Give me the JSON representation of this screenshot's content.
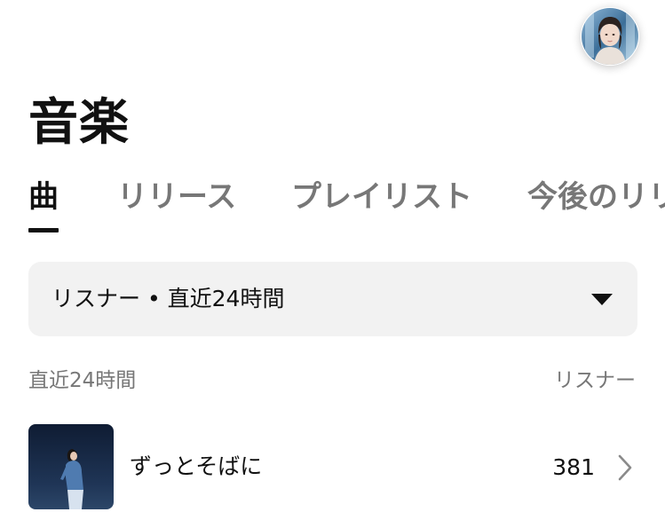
{
  "header": {
    "title": "音楽",
    "avatar_icon": "profile-avatar"
  },
  "tabs": [
    {
      "label": "曲",
      "active": true
    },
    {
      "label": "リリース",
      "active": false
    },
    {
      "label": "プレイリスト",
      "active": false
    },
    {
      "label": "今後のリリース",
      "active": false
    }
  ],
  "filter": {
    "label": "リスナー • 直近24時間",
    "icon": "caret-down-icon"
  },
  "section": {
    "period_label": "直近24時間",
    "metric_label": "リスナー"
  },
  "songs": [
    {
      "title": "ずっとそばに",
      "listeners": "381",
      "icon": "chevron-right-icon"
    }
  ],
  "colors": {
    "text_primary": "#111111",
    "text_secondary": "#777777",
    "filter_background": "#f2f2f2",
    "background": "#ffffff"
  }
}
